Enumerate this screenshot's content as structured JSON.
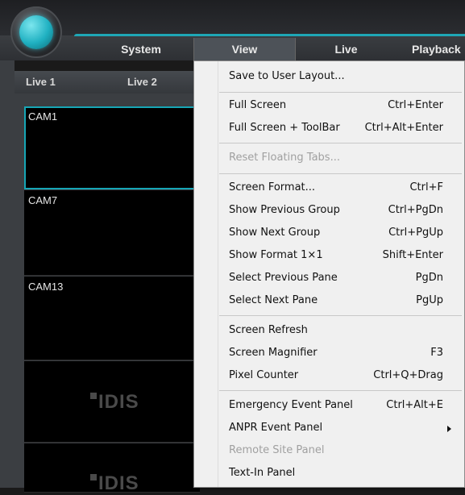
{
  "menubar": {
    "items": [
      "System",
      "View",
      "Live",
      "Playback"
    ]
  },
  "tabs": [
    "Live 1",
    "Live 2"
  ],
  "panes": [
    {
      "label": "CAM1",
      "selected": true
    },
    {
      "label": "CAM7"
    },
    {
      "label": "CAM13"
    },
    {
      "label": ""
    },
    {
      "label": ""
    }
  ],
  "brand_watermark": "IDIS",
  "view_menu": {
    "items": [
      {
        "label": "Save to User Layout...",
        "shortcut": ""
      },
      {
        "label": "Full Screen",
        "shortcut": "Ctrl+Enter"
      },
      {
        "label": "Full Screen + ToolBar",
        "shortcut": "Ctrl+Alt+Enter"
      },
      {
        "label": "Reset Floating Tabs...",
        "shortcut": "",
        "disabled": true
      },
      {
        "label": "Screen Format...",
        "shortcut": "Ctrl+F"
      },
      {
        "label": "Show Previous Group",
        "shortcut": "Ctrl+PgDn"
      },
      {
        "label": "Show Next Group",
        "shortcut": "Ctrl+PgUp"
      },
      {
        "label": "Show Format 1×1",
        "shortcut": "Shift+Enter"
      },
      {
        "label": "Select Previous Pane",
        "shortcut": "PgDn"
      },
      {
        "label": "Select Next Pane",
        "shortcut": "PgUp"
      },
      {
        "label": "Screen Refresh",
        "shortcut": ""
      },
      {
        "label": "Screen Magnifier",
        "shortcut": "F3"
      },
      {
        "label": "Pixel Counter",
        "shortcut": "Ctrl+Q+Drag"
      },
      {
        "label": "Emergency Event Panel",
        "shortcut": "Ctrl+Alt+E"
      },
      {
        "label": "ANPR Event Panel",
        "shortcut": "",
        "submenu": true
      },
      {
        "label": "Remote Site Panel",
        "shortcut": "",
        "disabled": true
      },
      {
        "label": "Text-In Panel",
        "shortcut": ""
      }
    ]
  },
  "colors": {
    "accent": "#1ea7b6",
    "menu_bg": "#f0f0f0",
    "disabled_text": "#a0a0a0"
  }
}
